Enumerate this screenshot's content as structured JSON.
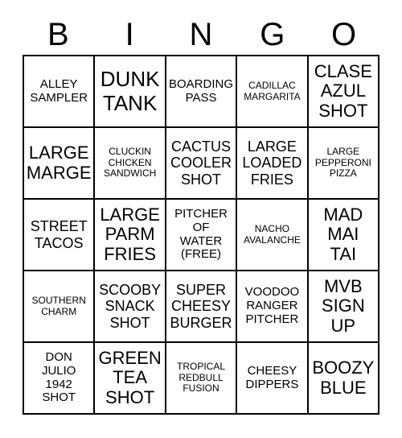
{
  "card": {
    "title": "BINGO",
    "header_letters": [
      "B",
      "I",
      "N",
      "G",
      "O"
    ],
    "columns": 5,
    "rows": 5,
    "colors": {
      "background": "#ffffff",
      "border": "#000000",
      "text": "#000000"
    },
    "cells": [
      [
        {
          "text": "ALLEY\nSAMPLER",
          "size": "sm"
        },
        {
          "text": "DUNK\nTANK",
          "size": "xl"
        },
        {
          "text": "BOARDING\nPASS",
          "size": "sm"
        },
        {
          "text": "CADILLAC\nMARGARITA",
          "size": "xs"
        },
        {
          "text": "CLASE\nAZUL\nSHOT",
          "size": "lg"
        }
      ],
      [
        {
          "text": "LARGE\nMARGE",
          "size": "lg"
        },
        {
          "text": "CLUCKIN\nCHICKEN\nSANDWICH",
          "size": "xs"
        },
        {
          "text": "CACTUS\nCOOLER\nSHOT",
          "size": "md"
        },
        {
          "text": "LARGE\nLOADED\nFRIES",
          "size": "md"
        },
        {
          "text": "LARGE\nPEPPERONI\nPIZZA",
          "size": "xs"
        }
      ],
      [
        {
          "text": "STREET\nTACOS",
          "size": "md"
        },
        {
          "text": "LARGE\nPARM\nFRIES",
          "size": "lg"
        },
        {
          "text": "PITCHER\nOF\nWATER\n(FREE)",
          "size": "sm"
        },
        {
          "text": "NACHO\nAVALANCHE",
          "size": "xs"
        },
        {
          "text": "MAD\nMAI\nTAI",
          "size": "lg"
        }
      ],
      [
        {
          "text": "SOUTHERN\nCHARM",
          "size": "xs"
        },
        {
          "text": "SCOOBY\nSNACK\nSHOT",
          "size": "md"
        },
        {
          "text": "SUPER\nCHEESY\nBURGER",
          "size": "md"
        },
        {
          "text": "VOODOO\nRANGER\nPITCHER",
          "size": "sm"
        },
        {
          "text": "MVB\nSIGN\nUP",
          "size": "lg"
        }
      ],
      [
        {
          "text": "DON\nJULIO\n1942\nSHOT",
          "size": "sm"
        },
        {
          "text": "GREEN\nTEA\nSHOT",
          "size": "lg"
        },
        {
          "text": "TROPICAL\nREDBULL\nFUSION",
          "size": "xs"
        },
        {
          "text": "CHEESY\nDIPPERS",
          "size": "sm"
        },
        {
          "text": "BOOZY\nBLUE",
          "size": "lg"
        }
      ]
    ]
  }
}
